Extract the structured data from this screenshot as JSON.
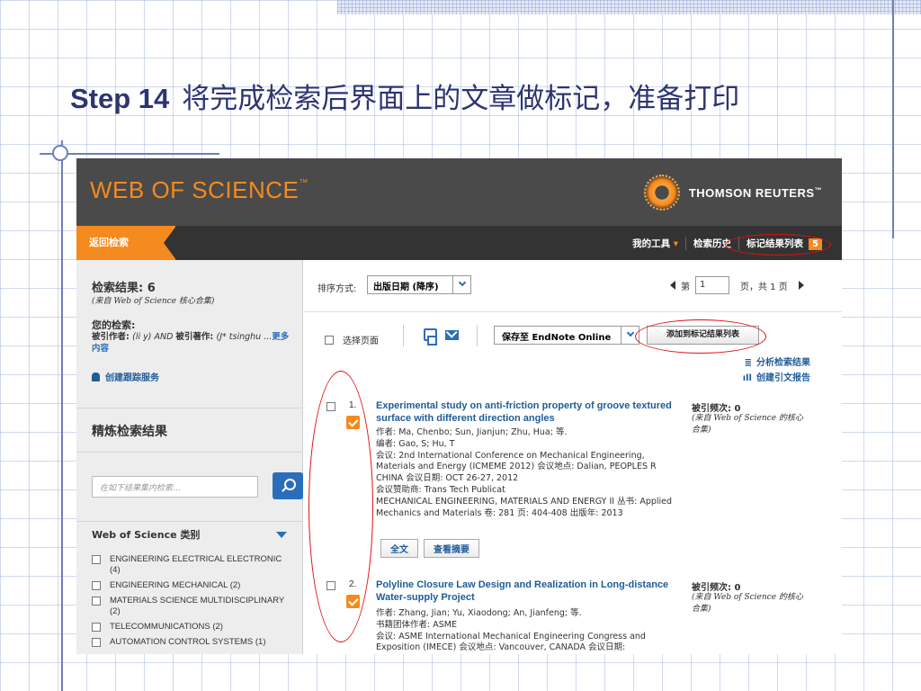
{
  "slide": {
    "step_label": "Step 14",
    "title_text": "将完成检索后界面上的文章做标记，准备打印"
  },
  "header": {
    "logo": "WEB OF SCIENCE",
    "logo_tm": "™",
    "publisher": "THOMSON REUTERS",
    "publisher_tm": "™"
  },
  "navbar": {
    "back_label": "返回检索",
    "my_tools_label": "我的工具",
    "history_label": "检索历史",
    "marked_list_label": "标记结果列表",
    "marked_count": "5"
  },
  "sidebar": {
    "results_label": "检索结果: 6",
    "results_source": "(来自 Web of Science 核心合集)",
    "your_search_label": "您的检索:",
    "query_prefix": "被引作者: ",
    "query_author": "(li y) AND ",
    "query_mid": "被引著作: ",
    "query_work": "(J* tsinghu ...",
    "more_link": "更多内容",
    "alert_link": "创建跟踪服务",
    "refine_title": "精炼检索结果",
    "refine_placeholder": "在如下结果集内检索...",
    "category_title": "Web of Science 类别",
    "categories": [
      {
        "label": "ENGINEERING ELECTRICAL ELECTRONIC (4)"
      },
      {
        "label": "ENGINEERING MECHANICAL (2)"
      },
      {
        "label": "MATERIALS SCIENCE MULTIDISCIPLINARY (2)"
      },
      {
        "label": "TELECOMMUNICATIONS (2)"
      },
      {
        "label": "AUTOMATION CONTROL SYSTEMS (1)"
      }
    ]
  },
  "toolbar": {
    "sort_label": "排序方式:",
    "sort_value": "出版日期 (降序)",
    "page_prefix": "第",
    "page_value": "1",
    "page_suffix": "页，共 1 页",
    "select_page_label": "选择页面",
    "save_value": "保存至 EndNote Online",
    "add_to_list_label": "添加到标记结果列表",
    "analyze_label": "分析检索结果",
    "citation_report_label": "创建引文报告"
  },
  "records": [
    {
      "num": "1.",
      "title": "Experimental study on anti-friction property of groove textured surface with different direction angles",
      "meta": [
        "作者: Ma, Chenbo; Sun, Jianjun; Zhu, Hua; 等.",
        "编者: Gao, S; Hu, T",
        "会议: 2nd International Conference on Mechanical Engineering, Materials and Energy (ICMEME 2012) 会议地点: Dalian, PEOPLES R CHINA 会议日期: OCT 26-27, 2012",
        "会议赞助商: Trans Tech Publicat",
        "MECHANICAL ENGINEERING, MATERIALS AND ENERGY II 丛书: Applied Mechanics and Materials 卷: 281 页: 404-408 出版年: 2013"
      ],
      "full_text_btn": "全文",
      "abstract_btn": "查看摘要",
      "cite_label": "被引频次: 0",
      "cite_source": "(来自 Web of Science 的核心合集)"
    },
    {
      "num": "2.",
      "title": "Polyline Closure Law Design and Realization in Long-distance Water-supply Project",
      "meta": [
        "作者: Zhang, Jian; Yu, Xiaodong; An, Jianfeng; 等.",
        "书籍团体作者: ASME",
        "会议: ASME International Mechanical Engineering Congress and Exposition (IMECE) 会议地点: Vancouver, CANADA 会议日期:"
      ],
      "cite_label": "被引频次: 0",
      "cite_source": "(来自 Web of Science 的核心合集)"
    }
  ]
}
